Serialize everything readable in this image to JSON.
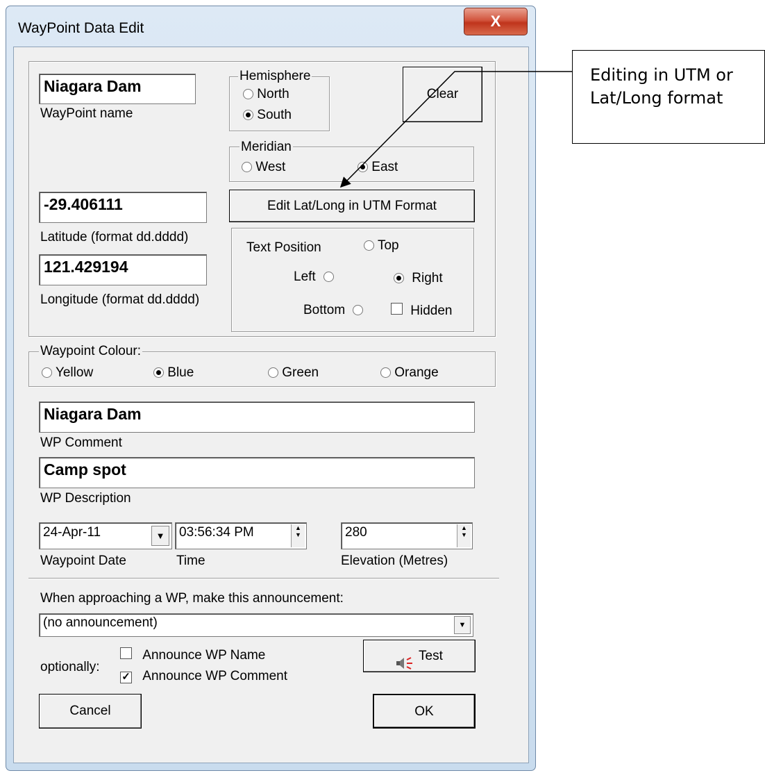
{
  "window": {
    "title": "WayPoint Data Edit",
    "close_glyph": "X"
  },
  "waypoint_name": {
    "value": "Niagara Dam",
    "label": "WayPoint name"
  },
  "hemisphere": {
    "legend": "Hemisphere",
    "options": [
      "North",
      "South"
    ],
    "selected": "South"
  },
  "clear_button": "Clear",
  "meridian": {
    "legend": "Meridian",
    "options": [
      "West",
      "East"
    ],
    "selected": "East"
  },
  "edit_format_button": "Edit Lat/Long in UTM Format",
  "latitude": {
    "value": "-29.406111",
    "label": "Latitude (format dd.dddd)"
  },
  "longitude": {
    "value": "121.429194",
    "label": "Longitude (format dd.dddd)"
  },
  "text_position": {
    "label": "Text Position",
    "top": "Top",
    "left": "Left",
    "right": "Right",
    "bottom": "Bottom",
    "hidden": "Hidden",
    "selected": "Right",
    "hidden_checked": false
  },
  "colour": {
    "legend": "Waypoint Colour:",
    "options": [
      "Yellow",
      "Blue",
      "Green",
      "Orange"
    ],
    "selected": "Blue"
  },
  "comment": {
    "value": "Niagara Dam",
    "label": "WP Comment"
  },
  "description": {
    "value": "Camp spot",
    "label": "WP Description"
  },
  "date": {
    "value": "24-Apr-11",
    "label": "Waypoint Date"
  },
  "time": {
    "value": "03:56:34 PM",
    "label": "Time"
  },
  "elevation": {
    "value": "280",
    "label": "Elevation (Metres)"
  },
  "announcement": {
    "prompt": "When approaching a WP, make this announcement:",
    "selected": "(no announcement)"
  },
  "optionally": {
    "label": "optionally:",
    "announce_name": "Announce WP Name",
    "announce_name_checked": false,
    "announce_comment": "Announce WP Comment",
    "announce_comment_checked": true
  },
  "test_button": "Test",
  "cancel_button": "Cancel",
  "ok_button": "OK",
  "callout": {
    "line1": "Editing in UTM or",
    "line2": "Lat/Long format"
  }
}
